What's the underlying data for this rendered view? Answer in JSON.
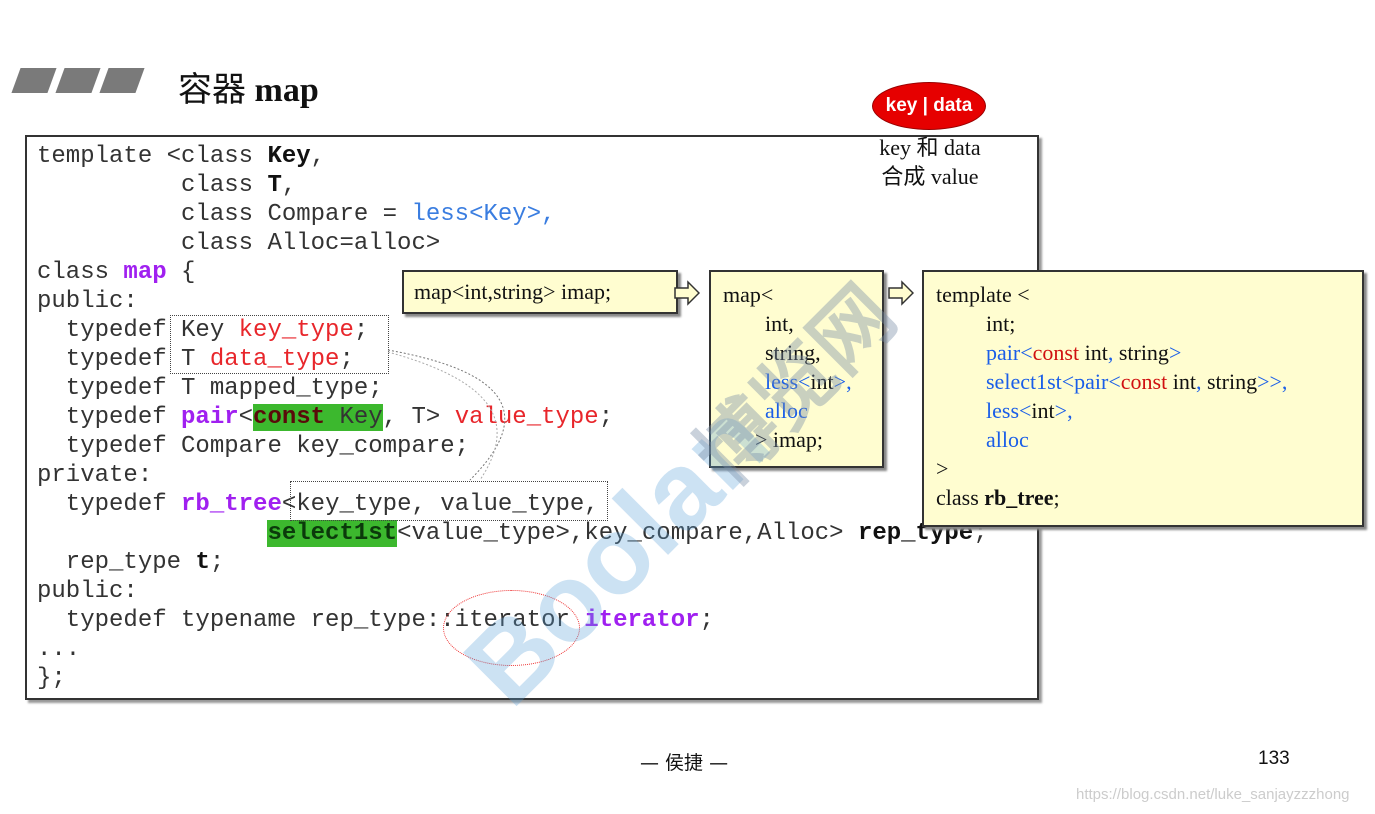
{
  "slide": {
    "title_cn": "容器",
    "title_en": "map",
    "page_number": "133",
    "footer": "— 侯捷 —",
    "url": "https://blog.csdn.net/luke_sanjayzzzhong"
  },
  "badge": {
    "text": "key | data",
    "color": "#e60000"
  },
  "caption": {
    "line1": "key 和 data",
    "line2": "合成 value"
  },
  "code_lines": [
    [
      [
        "template <class ",
        ""
      ],
      [
        "Key",
        "bold"
      ],
      [
        ",",
        ""
      ]
    ],
    [
      [
        "          class ",
        ""
      ],
      [
        "T",
        "bold"
      ],
      [
        ",",
        ""
      ]
    ],
    [
      [
        "          class Compare = ",
        ""
      ],
      [
        "less<Key>,",
        "b"
      ]
    ],
    [
      [
        "          class Alloc=alloc>",
        ""
      ]
    ],
    [
      [
        "class ",
        ""
      ],
      [
        "map",
        "k"
      ],
      [
        " {",
        ""
      ]
    ],
    [
      [
        "public:",
        ""
      ]
    ],
    [
      [
        "  typedef Key ",
        ""
      ],
      [
        "key_type",
        "r"
      ],
      [
        ";",
        ""
      ]
    ],
    [
      [
        "  typedef T ",
        ""
      ],
      [
        "data_type",
        "r"
      ],
      [
        ";",
        ""
      ]
    ],
    [
      [
        "  typedef T mapped_type;",
        ""
      ]
    ],
    [
      [
        "  typedef ",
        ""
      ],
      [
        "pair",
        "k"
      ],
      [
        "<",
        ""
      ],
      [
        "const",
        "hlk"
      ],
      [
        " Key",
        "hl"
      ],
      [
        ", T> ",
        ""
      ],
      [
        "value_type",
        "r"
      ],
      [
        ";",
        ""
      ]
    ],
    [
      [
        "  typedef Compare key_compare;",
        ""
      ]
    ],
    [
      [
        "private:",
        ""
      ]
    ],
    [
      [
        "  typedef ",
        ""
      ],
      [
        "rb_tree",
        "k"
      ],
      [
        "<key_type, value_type,",
        ""
      ]
    ],
    [
      [
        "                ",
        ""
      ],
      [
        "select1st",
        "hls"
      ],
      [
        "<value_type>,key_compare,Alloc> ",
        ""
      ],
      [
        "rep_type",
        "bold"
      ],
      [
        ";",
        ""
      ]
    ],
    [
      [
        "  rep_type ",
        ""
      ],
      [
        "t",
        "bold"
      ],
      [
        ";",
        ""
      ]
    ],
    [
      [
        "public:",
        ""
      ]
    ],
    [
      [
        "  typedef typename rep_type::iterator ",
        ""
      ],
      [
        "iterator",
        "k"
      ],
      [
        ";",
        ""
      ]
    ],
    [
      [
        "...",
        ""
      ]
    ],
    [
      [
        "};",
        ""
      ]
    ]
  ],
  "note1": {
    "text": "map<int,string> imap;"
  },
  "note2": {
    "lines": [
      [
        [
          "map<",
          ""
        ]
      ],
      [
        [
          "int,",
          ""
        ]
      ],
      [
        [
          "string,",
          ""
        ]
      ],
      [
        [
          "less<",
          "blue"
        ],
        [
          "int",
          ""
        ],
        [
          ">,",
          "blue"
        ]
      ],
      [
        [
          "alloc",
          "blue"
        ]
      ],
      [
        [
          "> imap;",
          ""
        ]
      ]
    ]
  },
  "note3": {
    "lines": [
      [
        [
          "template <",
          ""
        ]
      ],
      [
        [
          "int;",
          ""
        ]
      ],
      [
        [
          "pair<",
          "blue"
        ],
        [
          "const",
          "red"
        ],
        [
          " int",
          ""
        ],
        [
          ", ",
          "blue"
        ],
        [
          "string",
          ""
        ],
        [
          ">",
          "blue"
        ]
      ],
      [
        [
          "select1st<pair<",
          "blue"
        ],
        [
          "const",
          "red"
        ],
        [
          " int",
          ""
        ],
        [
          ", ",
          "blue"
        ],
        [
          "string",
          ""
        ],
        [
          ">>,",
          "blue"
        ]
      ],
      [
        [
          "less<",
          "blue"
        ],
        [
          "int",
          ""
        ],
        [
          ">,",
          "blue"
        ]
      ],
      [
        [
          "alloc",
          "blue"
        ]
      ],
      [
        [
          ">",
          ""
        ]
      ],
      [
        [
          "class ",
          ""
        ],
        [
          "rb_tree",
          "bold"
        ],
        [
          ";",
          ""
        ]
      ]
    ]
  },
  "watermark": {
    "brand": "Boolan",
    "cn": "博览网"
  },
  "colors": {
    "keyword": "#a020f0",
    "highlight": "#3cb82e",
    "note_bg": "#fffdd0",
    "accent_red": "#e8262b",
    "accent_blue": "#3a7de0"
  }
}
